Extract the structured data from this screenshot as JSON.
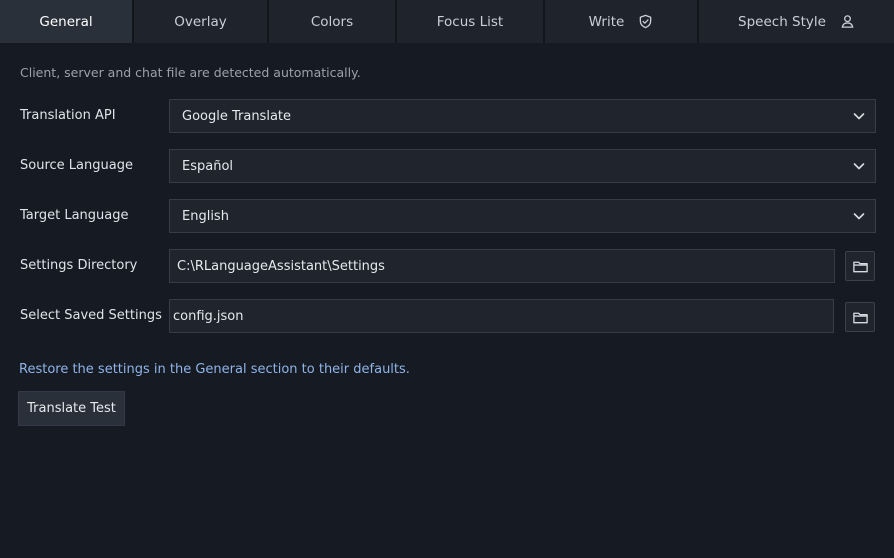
{
  "tabs": [
    {
      "label": "General",
      "active": true
    },
    {
      "label": "Overlay"
    },
    {
      "label": "Colors"
    },
    {
      "label": "Focus List"
    },
    {
      "label": "Write",
      "icon": "shield-check-icon"
    },
    {
      "label": "Speech Style",
      "icon": "user-icon"
    }
  ],
  "general": {
    "hint": "Client, server and chat file are detected automatically.",
    "translation_api": {
      "label": "Translation API",
      "value": "Google Translate"
    },
    "source_language": {
      "label": "Source Language",
      "value": "Español"
    },
    "target_language": {
      "label": "Target Language",
      "value": "English"
    },
    "settings_directory": {
      "label": "Settings Directory",
      "value": "C:\\RLanguageAssistant\\Settings"
    },
    "saved_settings": {
      "label": "Select Saved Settings",
      "value": "config.json"
    },
    "restore_link": "Restore the settings in the General section to their defaults.",
    "translate_test_button": "Translate Test"
  },
  "colors": {
    "background": "#161a22",
    "tab_active": "#2a303a",
    "link": "#8fb4e8"
  }
}
